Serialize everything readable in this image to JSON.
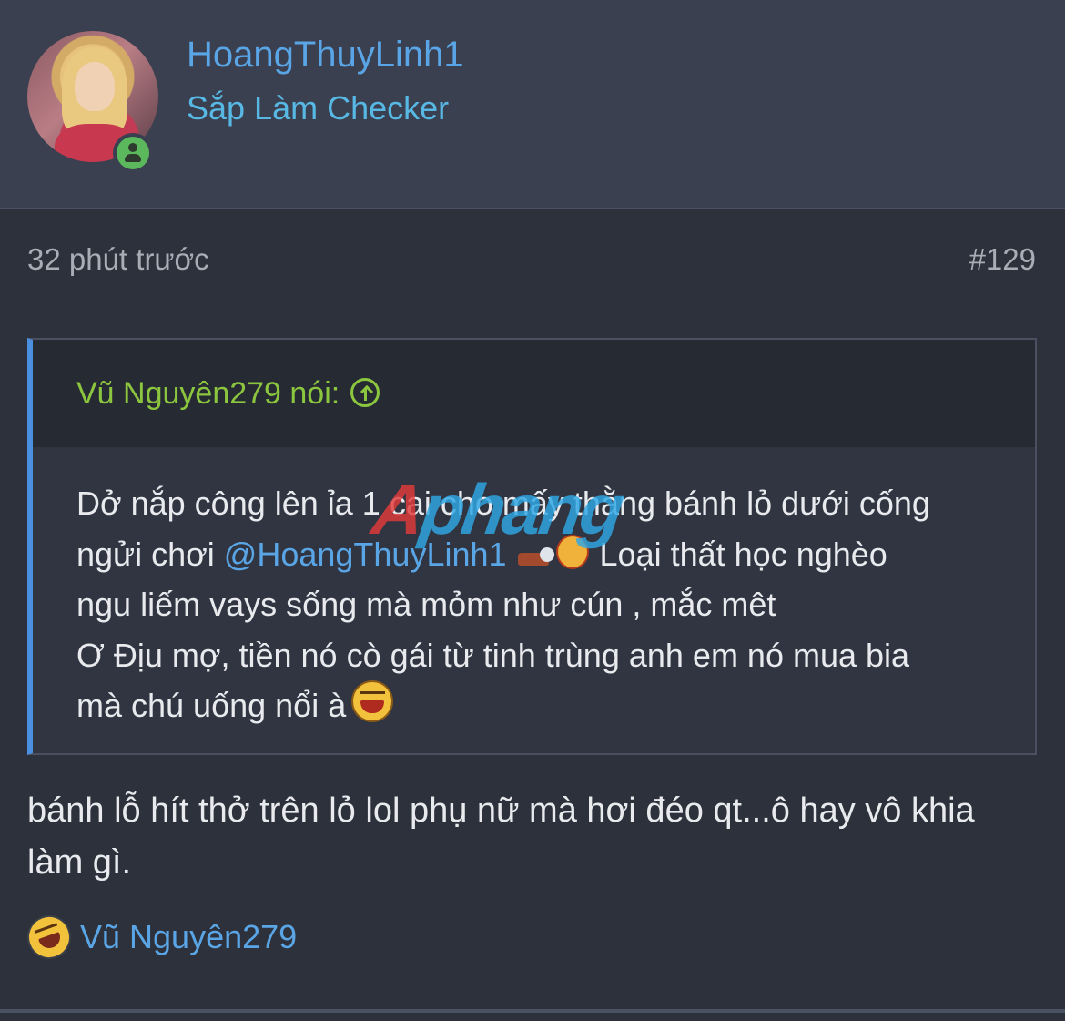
{
  "post": {
    "username": "HoangThuyLinh1",
    "user_title": "Sắp Làm Checker",
    "time": "32 phút trước",
    "post_number": "#129"
  },
  "quote": {
    "author_label": "Vũ Nguyên279 nói:",
    "lines": [
      {
        "text": "Dở nắp công lên ỉa 1 cai cho mấy thằng bánh lỏ dưới cống"
      },
      {
        "prefix": "ngửi chơi ",
        "mention": "@HoangThuyLinh1",
        "suffix": "Loại thất học nghèo"
      },
      {
        "text": "ngu liếm vays sống mà mỏm như cún , mắc mêt"
      },
      {
        "text": "Ơ Địu mợ, tiền nó cò gái từ tinh trùng anh em nó mua bia"
      },
      {
        "text": "mà chú uống nổi à"
      }
    ]
  },
  "watermark": {
    "first": "A",
    "rest": "phang"
  },
  "reply": {
    "text": "bánh lỗ hít thở trên lỏ lol phụ nữ mà hơi đéo qt...ô hay vô khia làm gì."
  },
  "reaction": {
    "icon": "laughing-face-icon",
    "user": "Vũ Nguyên279"
  },
  "colors": {
    "username": "#5aa5e6",
    "user_title": "#58b8e4",
    "quote_author": "#8cc63f",
    "quote_accent": "#4a8fe0",
    "online": "#5cb85c"
  }
}
